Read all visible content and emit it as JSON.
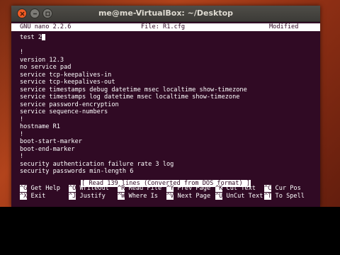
{
  "window": {
    "title": "me@me-VirtualBox: ~/Desktop"
  },
  "nano": {
    "version": "GNU nano 2.2.6",
    "file": "File: R1.cfg",
    "state": "Modified",
    "lines": [
      "test 2",
      "",
      "!",
      "version 12.3",
      "no service pad",
      "service tcp-keepalives-in",
      "service tcp-keepalives-out",
      "service timestamps debug datetime msec localtime show-timezone",
      "service timestamps log datetime msec localtime show-timezone",
      "service password-encryption",
      "service sequence-numbers",
      "!",
      "hostname R1",
      "!",
      "boot-start-marker",
      "boot-end-marker",
      "!",
      "security authentication failure rate 3 log",
      "security passwords min-length 6"
    ],
    "status": "[ Read 139 lines (Converted from DOS format) ]",
    "shortcuts_row1": [
      {
        "key": "^G",
        "label": "Get Help"
      },
      {
        "key": "^O",
        "label": "WriteOut"
      },
      {
        "key": "^R",
        "label": "Read File"
      },
      {
        "key": "^Y",
        "label": "Prev Page"
      },
      {
        "key": "^K",
        "label": "Cut Text"
      },
      {
        "key": "^C",
        "label": "Cur Pos"
      }
    ],
    "shortcuts_row2": [
      {
        "key": "^X",
        "label": "Exit"
      },
      {
        "key": "^J",
        "label": "Justify"
      },
      {
        "key": "^W",
        "label": "Where Is"
      },
      {
        "key": "^V",
        "label": "Next Page"
      },
      {
        "key": "^U",
        "label": "UnCut Text"
      },
      {
        "key": "^T",
        "label": "To Spell"
      }
    ]
  },
  "colors": {
    "terminal_bg": "#300a24",
    "text": "#ffffff",
    "close_button": "#f05b24"
  }
}
